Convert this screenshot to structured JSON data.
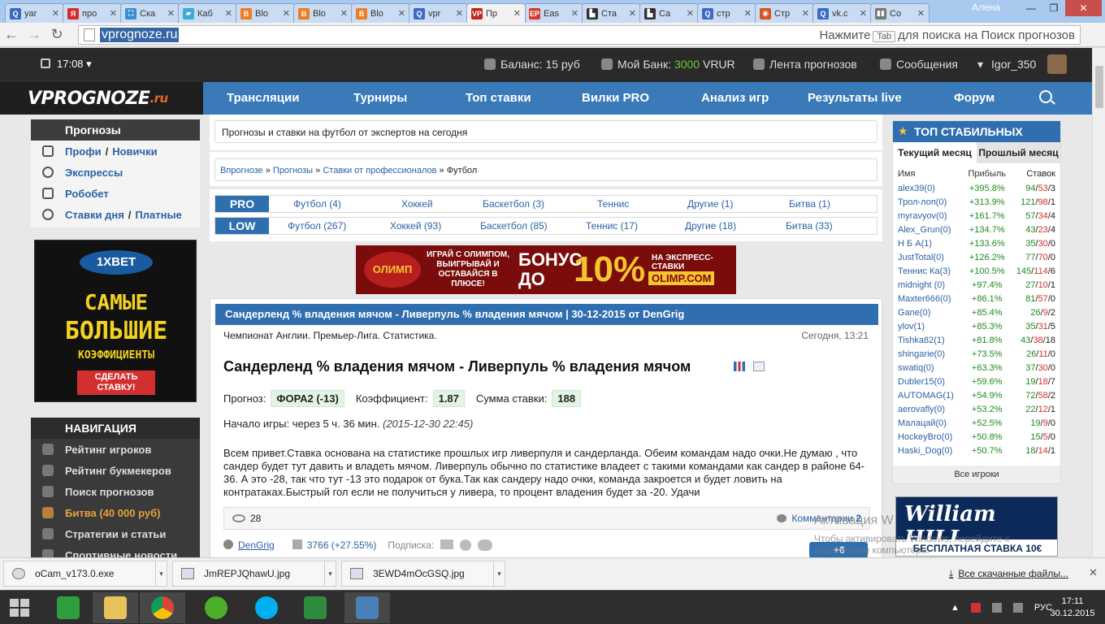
{
  "browser": {
    "tabs": [
      {
        "label": "yar",
        "color": "#3b6bc4",
        "glyph": "Q"
      },
      {
        "label": "про",
        "color": "#d92a2a",
        "glyph": "Я"
      },
      {
        "label": "Ска",
        "color": "#3b8dd1",
        "glyph": "⛶"
      },
      {
        "label": "Каб",
        "color": "#3fa9d9",
        "glyph": "▰"
      },
      {
        "label": "Blo",
        "color": "#f07c1e",
        "glyph": "B"
      },
      {
        "label": "Blo",
        "color": "#f07c1e",
        "glyph": "B"
      },
      {
        "label": "Blo",
        "color": "#f07c1e",
        "glyph": "B"
      },
      {
        "label": "vpr",
        "color": "#3b6bc4",
        "glyph": "Q"
      },
      {
        "label": "Пр",
        "color": "#c0261c",
        "glyph": "VP",
        "active": true
      },
      {
        "label": "Eas",
        "color": "#d63a2a",
        "glyph": "EP"
      },
      {
        "label": "Ста",
        "color": "#333333",
        "glyph": "▙"
      },
      {
        "label": "Ca",
        "color": "#333333",
        "glyph": "▙"
      },
      {
        "label": "стр",
        "color": "#3b6bc4",
        "glyph": "Q"
      },
      {
        "label": "Стр",
        "color": "#d9531e",
        "glyph": "◉"
      },
      {
        "label": "vk.c",
        "color": "#3b6bc4",
        "glyph": "Q"
      },
      {
        "label": "Со",
        "color": "#777777",
        "glyph": "▮▮"
      }
    ],
    "user": "Алена",
    "url": "vprognoze.ru",
    "hint_prefix": "Нажмите",
    "hint_key": "Tab",
    "hint_suffix": "для поиска на Поиск прогнозов"
  },
  "topbar": {
    "time": "17:08",
    "balance": "Баланс: 15 руб",
    "bank_label": "Мой Банк:",
    "bank_value": "3000",
    "bank_currency": "VRUR",
    "feed": "Лента прогнозов",
    "messages": "Сообщения",
    "username": "Igor_350"
  },
  "logo": {
    "main": "VPROGNOZE",
    "suffix": ".ru"
  },
  "nav": [
    "Трансляции",
    "Турниры",
    "Топ ставки",
    "Вилки PRO",
    "Анализ игр",
    "Результаты live",
    "Форум"
  ],
  "left_prognoz": {
    "title": "Прогнозы",
    "rows": [
      {
        "a": "Профи",
        "b": "Новички"
      },
      {
        "a": "Экспрессы",
        "b": ""
      },
      {
        "a": "Робобет",
        "b": ""
      },
      {
        "a": "Ставки дня",
        "b": "Платные"
      }
    ],
    "slash": "/"
  },
  "banner_1x": {
    "brand": "1XBET",
    "line1": "САМЫЕ",
    "line2": "БОЛЬШИЕ",
    "line3": "КОЭФФИЦИЕНТЫ",
    "button": "СДЕЛАТЬ СТАВКУ!"
  },
  "left_nav": {
    "title": "НАВИГАЦИЯ",
    "items": [
      "Рейтинг игроков",
      "Рейтинг букмекеров",
      "Поиск прогнозов",
      "Битва (40 000 руб)",
      "Стратегии и статьи",
      "Спортивные новости"
    ]
  },
  "tagline": "Прогнозы и ставки на футбол от экспертов на сегодня",
  "breadcrumb": {
    "items": [
      "Впрогнозе",
      "Прогнозы",
      "Ставки от профессионалов"
    ],
    "current": "Футбол",
    "sep": "»"
  },
  "cats": {
    "pro_label": "PRO",
    "pro": [
      "Футбол (4)",
      "Хоккей",
      "Баскетбол (3)",
      "Теннис",
      "Другие (1)",
      "Битва (1)"
    ],
    "low_label": "LOW",
    "low": [
      "Футбол (267)",
      "Хоккей (93)",
      "Баскетбол (85)",
      "Теннис (17)",
      "Другие (18)",
      "Битва (33)"
    ]
  },
  "olimp_ad": {
    "brand": "ОЛИМП",
    "text": "ИГРАЙ С ОЛИМПОМ, ВЫИГРЫВАЙ И ОСТАВАЙСЯ В ПЛЮСЕ!",
    "bonus": "БОНУС ДО",
    "percent": "10%",
    "sub": "НА ЭКСПРЕСС-СТАВКИ",
    "site": "OLIMP.COM"
  },
  "article": {
    "header": "Сандерленд % владения мячом - Ливерпуль % владения мячом | 30-12-2015 от DenGrig",
    "league": "Чемпионат Англии. Премьер-Лига. Статистика.",
    "date": "Сегодня, 13:21",
    "title": "Сандерленд % владения мячом - Ливерпуль % владения мячом",
    "forecast_label": "Прогноз:",
    "forecast_value": "ФОРА2 (-13)",
    "coef_label": "Коэффициент:",
    "coef_value": "1.87",
    "sum_label": "Сумма ставки:",
    "sum_value": "188",
    "start_label": "Начало игры: через 5 ч. 36 мин.",
    "start_date": "(2015-12-30 22:45)",
    "body": "Всем привет.Ставка основана на статистике прошлых игр ливерпуля и сандерланда. Обеим командам надо очки.Не думаю , что сандер будет тут давить и владеть мячом. Ливерпуль обычно по статистике владеет с такими командами как сандер в районе 64-36. А это -28, так что тут -13 это подарок от бука.Так как сандеру надо очки, команда закроется и будет ловить на контратаках.Быстрый гол если не получиться у ливера, то процент владения будет за -20. Удачи",
    "views": "28",
    "comments_label": "Комментарии",
    "comments_count": "2",
    "author": "DenGrig",
    "author_stats": "3766 (+27.55%)",
    "subscribe": "Подписка:",
    "vote_count": "+6"
  },
  "top_stable": {
    "title": "ТОП СТАБИЛЬНЫХ",
    "tab_current": "Текущий месяц",
    "tab_prev": "Прошлый месяц",
    "cols": [
      "Имя",
      "Прибыль",
      "Ставок"
    ],
    "rows": [
      {
        "name": "alex39(0)",
        "profit": "+395.8%",
        "w": "94",
        "l": "53",
        "d": "3"
      },
      {
        "name": "Трол-лоп(0)",
        "profit": "+313.9%",
        "w": "121",
        "l": "98",
        "d": "1"
      },
      {
        "name": "myravyov(0)",
        "profit": "+161.7%",
        "w": "57",
        "l": "34",
        "d": "4"
      },
      {
        "name": "Alex_Grun(0)",
        "profit": "+134.7%",
        "w": "43",
        "l": "23",
        "d": "4"
      },
      {
        "name": "Н Б А(1)",
        "profit": "+133.6%",
        "w": "35",
        "l": "30",
        "d": "0"
      },
      {
        "name": "JustTotal(0)",
        "profit": "+126.2%",
        "w": "77",
        "l": "70",
        "d": "0"
      },
      {
        "name": "Теннис Ка(3)",
        "profit": "+100.5%",
        "w": "145",
        "l": "114",
        "d": "6"
      },
      {
        "name": "midnight (0)",
        "profit": "+97.4%",
        "w": "27",
        "l": "10",
        "d": "1"
      },
      {
        "name": "Maxter666(0)",
        "profit": "+86.1%",
        "w": "81",
        "l": "57",
        "d": "0"
      },
      {
        "name": "Gane(0)",
        "profit": "+85.4%",
        "w": "26",
        "l": "9",
        "d": "2"
      },
      {
        "name": "ylov(1)",
        "profit": "+85.3%",
        "w": "35",
        "l": "31",
        "d": "5"
      },
      {
        "name": "Tishka82(1)",
        "profit": "+81.8%",
        "w": "43",
        "l": "38",
        "d": "18"
      },
      {
        "name": "shingarie(0)",
        "profit": "+73.5%",
        "w": "26",
        "l": "11",
        "d": "0"
      },
      {
        "name": "swatiq(0)",
        "profit": "+63.3%",
        "w": "37",
        "l": "30",
        "d": "0"
      },
      {
        "name": "Dubler15(0)",
        "profit": "+59.6%",
        "w": "19",
        "l": "18",
        "d": "7"
      },
      {
        "name": "AUTOMAG(1)",
        "profit": "+54.9%",
        "w": "72",
        "l": "58",
        "d": "2"
      },
      {
        "name": "aerovafly(0)",
        "profit": "+53.2%",
        "w": "22",
        "l": "12",
        "d": "1"
      },
      {
        "name": "Малацай(0)",
        "profit": "+52.5%",
        "w": "19",
        "l": "9",
        "d": "0"
      },
      {
        "name": "HockeyBro(0)",
        "profit": "+50.8%",
        "w": "15",
        "l": "5",
        "d": "0"
      },
      {
        "name": "Haski_Dog(0)",
        "profit": "+50.7%",
        "w": "18",
        "l": "14",
        "d": "1"
      }
    ],
    "all_players": "Все игроки"
  },
  "wh_banner": {
    "brand": "William HILL",
    "free": "БЕСПЛАТНАЯ СТАВКА 10€"
  },
  "activation": {
    "title": "Активация W",
    "text": "Чтобы активировать Windows, перейдите к параметрам компьютера."
  },
  "downloads": {
    "files": [
      "oCam_v173.0.exe",
      "JmREPJQhawU.jpg",
      "3EWD4mOcGSQ.jpg"
    ],
    "all": "Все скачанные файлы...",
    "close": "✕"
  },
  "taskbar": {
    "lang": "РУС",
    "time": "17:11",
    "date": "30.12.2015"
  }
}
